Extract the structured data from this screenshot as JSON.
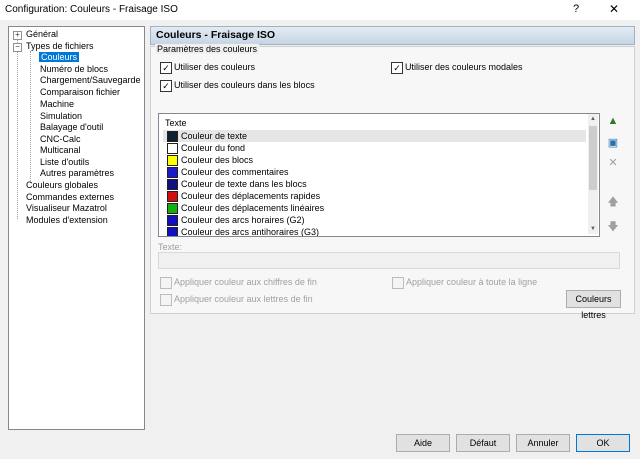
{
  "window": {
    "title": "Configuration: Couleurs - Fraisage ISO",
    "help_icon": "?",
    "close_icon": "✕"
  },
  "tree": {
    "items": [
      {
        "label": "Général",
        "level": 0,
        "expander": "+"
      },
      {
        "label": "Types de fichiers",
        "level": 0,
        "expander": "−"
      },
      {
        "label": "Couleurs",
        "level": 1,
        "selected": true
      },
      {
        "label": "Numéro de blocs",
        "level": 1
      },
      {
        "label": "Chargement/Sauvegarde",
        "level": 1
      },
      {
        "label": "Comparaison fichier",
        "level": 1
      },
      {
        "label": "Machine",
        "level": 1
      },
      {
        "label": "Simulation",
        "level": 1
      },
      {
        "label": "Balayage d'outil",
        "level": 1
      },
      {
        "label": "CNC-Calc",
        "level": 1
      },
      {
        "label": "Multicanal",
        "level": 1
      },
      {
        "label": "Liste d'outils",
        "level": 1
      },
      {
        "label": "Autres paramètres",
        "level": 1
      },
      {
        "label": "Couleurs globales",
        "level": 0
      },
      {
        "label": "Commandes externes",
        "level": 0
      },
      {
        "label": "Visualiseur Mazatrol",
        "level": 0
      },
      {
        "label": "Modules d'extension",
        "level": 0
      }
    ]
  },
  "header": {
    "title": "Couleurs - Fraisage ISO"
  },
  "group": {
    "label": "Paramètres des couleurs",
    "use_colors": {
      "label": "Utiliser des couleurs",
      "checked": true
    },
    "use_modal_colors": {
      "label": "Utiliser des couleurs modales",
      "checked": true
    },
    "use_block_colors": {
      "label": "Utiliser des couleurs dans les blocs",
      "checked": true
    }
  },
  "list": {
    "header": "Texte",
    "rows": [
      {
        "label": "Couleur de texte",
        "color": "#0c2233",
        "highlighted": true
      },
      {
        "label": "Couleur du fond",
        "color": "#ffffff"
      },
      {
        "label": "Couleur des blocs",
        "color": "#ffff00"
      },
      {
        "label": "Couleur des commentaires",
        "color": "#1a1ad0"
      },
      {
        "label": "Couleur de texte dans les blocs",
        "color": "#101080"
      },
      {
        "label": "Couleur des déplacements rapides",
        "color": "#d01010"
      },
      {
        "label": "Couleur des déplacements linéaires",
        "color": "#10b010"
      },
      {
        "label": "Couleur des arcs horaires (G2)",
        "color": "#1010c0"
      },
      {
        "label": "Couleur des arcs antihoraires (G3)",
        "color": "#1010c0"
      }
    ]
  },
  "side_buttons": {
    "add_icon": "mountain-add-icon",
    "edit_icon": "edit-color-icon",
    "delete_icon": "delete-icon",
    "up_icon": "arrow-up-icon",
    "down_icon": "arrow-down-icon"
  },
  "text_field": {
    "label": "Texte:",
    "value": ""
  },
  "options": {
    "apply_end_numbers": {
      "label": "Appliquer couleur aux chiffres de fin",
      "checked": false
    },
    "apply_whole_line": {
      "label": "Appliquer couleur à toute la ligne",
      "checked": false
    },
    "apply_end_letters": {
      "label": "Appliquer couleur aux lettres de fin",
      "checked": false
    },
    "letter_colors_button": "Couleurs lettres"
  },
  "footer": {
    "help": "Aide",
    "default": "Défaut",
    "cancel": "Annuler",
    "ok": "OK"
  }
}
